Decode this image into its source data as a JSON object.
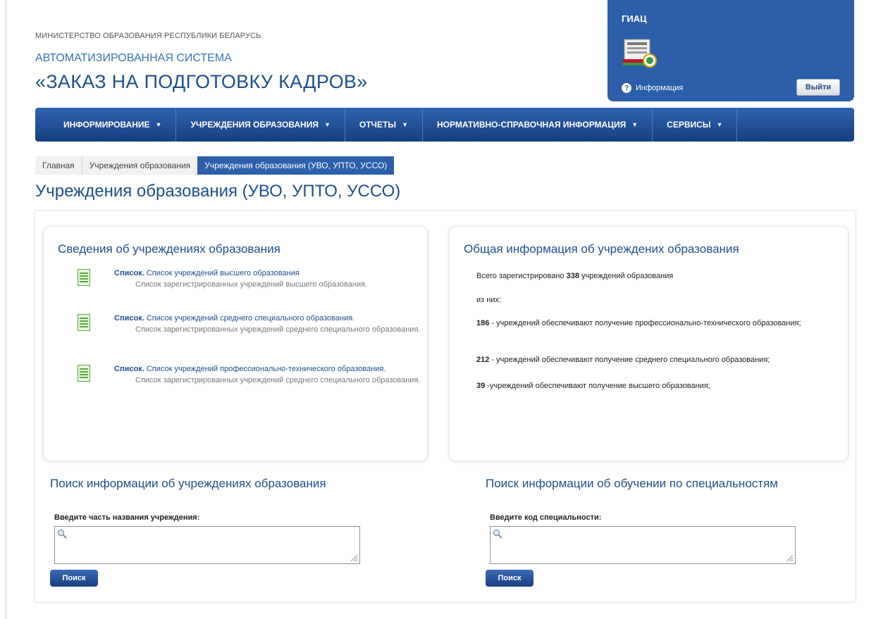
{
  "header": {
    "ministry": "МИНИСТЕРСТВО ОБРАЗОВАНИЯ РЕСПУБЛИКИ БЕЛАРУСЬ",
    "system": "АВТОМАТИЗИРОВАННАЯ СИСТЕМА",
    "title": "«ЗАКАЗ НА ПОДГОТОВКУ КАДРОВ»"
  },
  "giac": {
    "title": "ГИАЦ",
    "info_label": "Информация",
    "logout_label": "Выйти"
  },
  "nav": {
    "items": [
      {
        "label": "ИНФОРМИРОВАНИЕ"
      },
      {
        "label": "УЧРЕЖДЕНИЯ ОБРАЗОВАНИЯ"
      },
      {
        "label": "ОТЧЕТЫ"
      },
      {
        "label": "НОРМАТИВНО-СПРАВОЧНАЯ ИНФОРМАЦИЯ"
      },
      {
        "label": "СЕРВИСЫ"
      }
    ],
    "caret": "▼"
  },
  "breadcrumb": [
    "Главная",
    "Учреждения образования",
    "Учреждения образования (УВО, УПТО, УССО)"
  ],
  "page_title": "Учреждения образования (УВО, УПТО, УССО)",
  "left_card": {
    "title": "Сведения об учреждениях образования",
    "entries": [
      {
        "prefix": "Список.",
        "link": "Список учреждений высшего образования",
        "desc": "Список зарегистрированных учреждений высшего образования."
      },
      {
        "prefix": "Список.",
        "link": "Список учреждений среднего специального образования.",
        "desc": "Список зарегистрированных учреждений среднего специального образования."
      },
      {
        "prefix": "Список.",
        "link": "Список учреждений профессионально-технического образования.",
        "desc": "Список зарегистрированных учреждений среднего специального образования."
      }
    ]
  },
  "right_card": {
    "title": "Общая информация об учреждених образования",
    "total_pre": "Всего зарегистрировано",
    "total_num": "338",
    "total_post": "учреждений образования",
    "of_them": "из них:",
    "stats": [
      {
        "num": "186",
        "text": " - учреждений обеспечивают получение профессионально-технического образования;"
      },
      {
        "num": "212",
        "text": " - учреждений обеспечивают получение среднего специального образования;"
      },
      {
        "num": "39",
        "text": " -учреждений обеспечивают получение высшего образования;"
      }
    ]
  },
  "search_left": {
    "title": "Поиск информации об учреждениях образования",
    "label": "Введите часть названия учреждения:",
    "value": "",
    "button": "Поиск"
  },
  "search_right": {
    "title": "Поиск информации об обучении по специальностям",
    "label": "Введите код специальности:",
    "value": "",
    "button": "Поиск"
  },
  "colors": {
    "brand_blue": "#2c5ea9",
    "title_blue": "#1e4f8c"
  }
}
